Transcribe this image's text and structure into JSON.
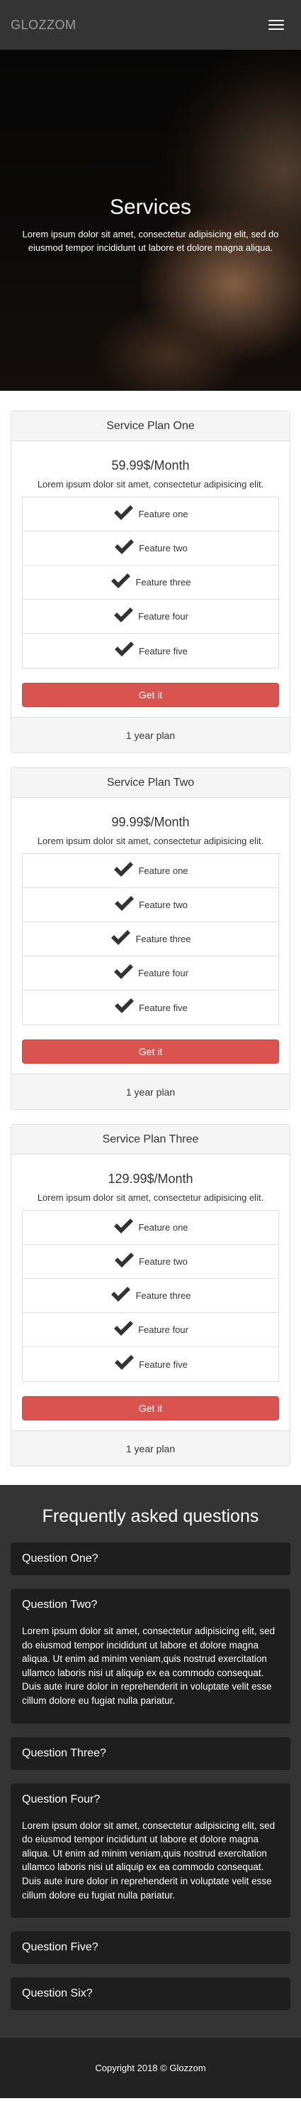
{
  "nav": {
    "brand": "GLOZZOM"
  },
  "hero": {
    "title": "Services",
    "text": "Lorem ipsum dolor sit amet, consectetur adipisicing elit, sed do eiusmod tempor incididunt ut labore et dolore magna aliqua."
  },
  "plans": [
    {
      "title": "Service Plan One",
      "price": "59.99$/Month",
      "desc": "Lorem ipsum dolor sit amet, consectetur adipisicing elit.",
      "features": [
        "Feature one",
        "Feature two",
        "Feature three",
        "Feature four",
        "Feature five"
      ],
      "button": "Get it",
      "footer": "1 year plan"
    },
    {
      "title": "Service Plan Two",
      "price": "99.99$/Month",
      "desc": "Lorem ipsum dolor sit amet, consectetur adipisicing elit.",
      "features": [
        "Feature one",
        "Feature two",
        "Feature three",
        "Feature four",
        "Feature five"
      ],
      "button": "Get it",
      "footer": "1 year plan"
    },
    {
      "title": "Service Plan Three",
      "price": "129.99$/Month",
      "desc": "Lorem ipsum dolor sit amet, consectetur adipisicing elit.",
      "features": [
        "Feature one",
        "Feature two",
        "Feature three",
        "Feature four",
        "Feature five"
      ],
      "button": "Get it",
      "footer": "1 year plan"
    }
  ],
  "faq": {
    "title": "Frequently asked questions",
    "questions": [
      {
        "q": "Question One?"
      },
      {
        "q": "Question Two?",
        "a": "Lorem ipsum dolor sit amet, consectetur adipisicing elit, sed do eiusmod tempor incididunt ut labore et dolore magna aliqua. Ut enim ad minim veniam,quis nostrud exercitation ullamco laboris nisi ut aliquip ex ea commodo consequat. Duis aute irure dolor in reprehenderit in voluptate velit esse cillum dolore eu fugiat nulla pariatur."
      },
      {
        "q": "Question Three?"
      },
      {
        "q": "Question Four?",
        "a": "Lorem ipsum dolor sit amet, consectetur adipisicing elit, sed do eiusmod tempor incididunt ut labore et dolore magna aliqua. Ut enim ad minim veniam,quis nostrud exercitation ullamco laboris nisi ut aliquip ex ea commodo consequat. Duis aute irure dolor in reprehenderit in voluptate velit esse cillum dolore eu fugiat nulla pariatur."
      },
      {
        "q": "Question Five?"
      },
      {
        "q": "Question Six?"
      }
    ]
  },
  "footer": {
    "text": "Copyright 2018 © Glozzom"
  },
  "icons": {
    "menu": "hamburger-menu-icon",
    "feature": "check-icon"
  },
  "colors": {
    "navbar": "#343434",
    "button": "#d9534f",
    "faq_bg": "#343434",
    "faq_card": "#1e1e1e",
    "footer": "#222222"
  }
}
